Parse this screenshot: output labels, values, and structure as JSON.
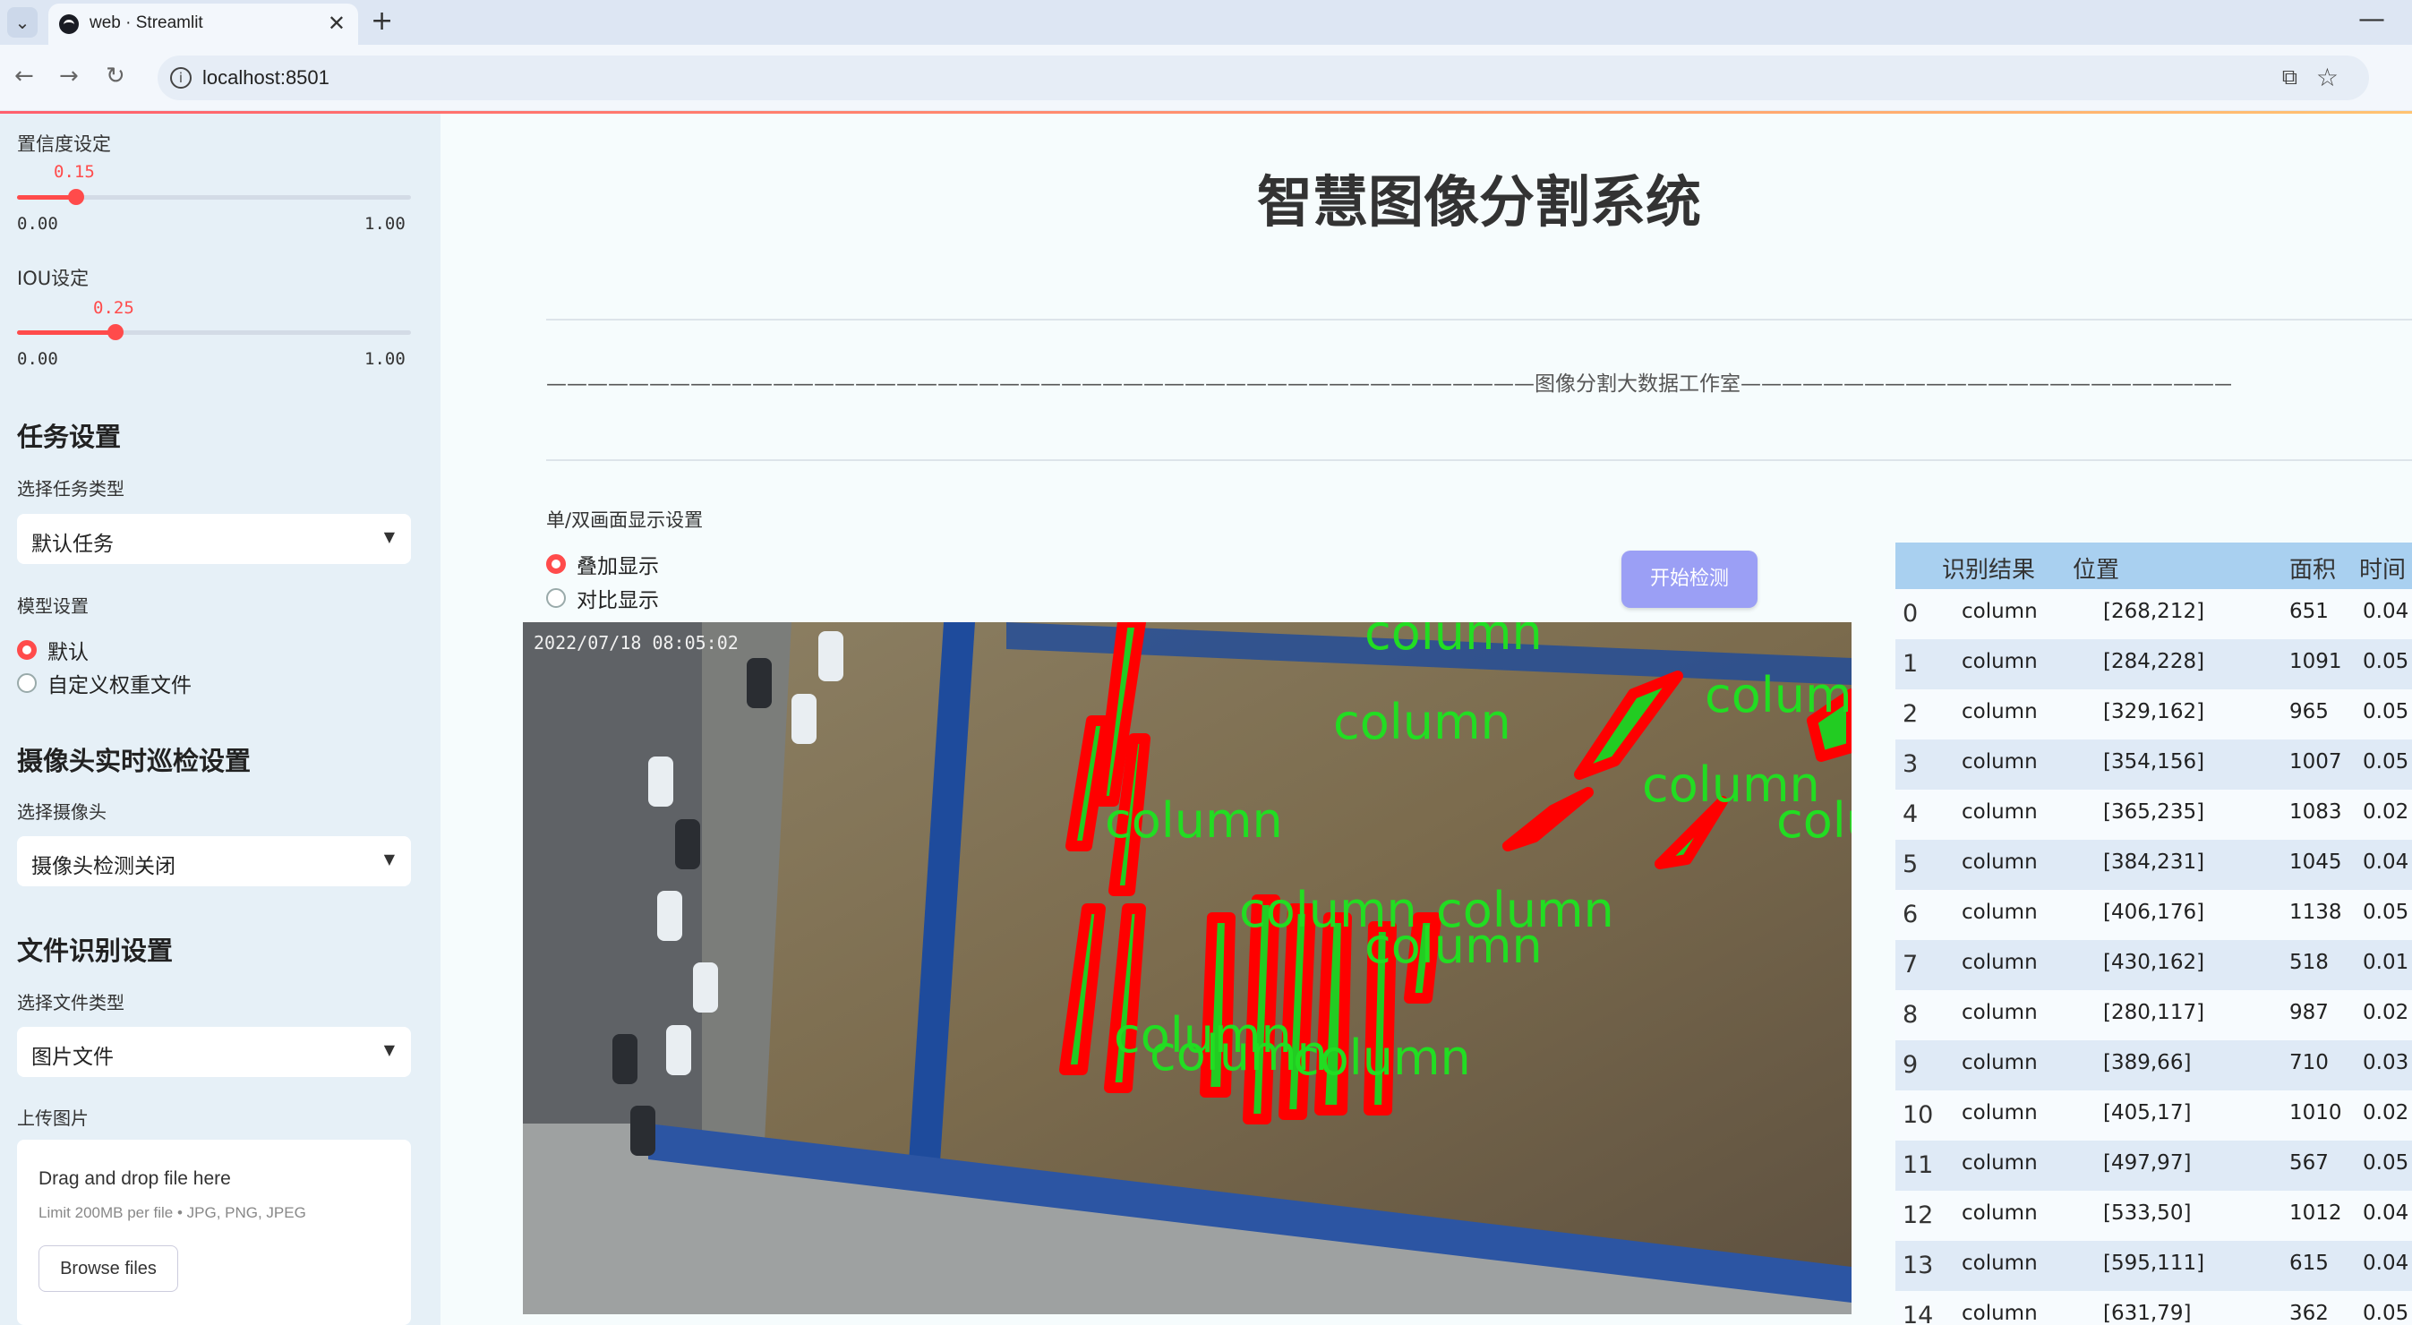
{
  "browser": {
    "tab_title": "web · Streamlit",
    "url": "localhost:8501"
  },
  "sidebar": {
    "confidence": {
      "label": "置信度设定",
      "value": "0.15",
      "value_num": 0.15,
      "min": "0.00",
      "max": "1.00"
    },
    "iou": {
      "label": "IOU设定",
      "value": "0.25",
      "value_num": 0.25,
      "min": "0.00",
      "max": "1.00"
    },
    "task_header": "任务设置",
    "task_type_label": "选择任务类型",
    "task_type_value": "默认任务",
    "model_label": "模型设置",
    "model_options": [
      "默认",
      "自定义权重文件"
    ],
    "model_selected": 0,
    "camera_header": "摄像头实时巡检设置",
    "camera_label": "选择摄像头",
    "camera_value": "摄像头检测关闭",
    "file_header": "文件识别设置",
    "file_type_label": "选择文件类型",
    "file_type_value": "图片文件",
    "upload_label": "上传图片",
    "upload_drag": "Drag and drop file here",
    "upload_limit": "Limit 200MB per file • JPG, PNG, JPEG",
    "upload_button": "Browse files"
  },
  "main": {
    "title": "智慧图像分割系统",
    "banner": "————————————————————————————————————————————————图像分割大数据工作室————————————————————————————————————————————————",
    "display_label": "单/双画面显示设置",
    "display_options": [
      "叠加显示",
      "对比显示"
    ],
    "display_selected": 0,
    "start_button": "开始检测",
    "image": {
      "timestamp": "2022/07/18 08:05:02",
      "detection_label": "column"
    }
  },
  "table": {
    "headers": [
      "识别结果",
      "位置",
      "面积",
      "时间"
    ],
    "rows": [
      {
        "idx": "0",
        "result": "column",
        "pos": "[268,212]",
        "area": "651",
        "time": "0.04"
      },
      {
        "idx": "1",
        "result": "column",
        "pos": "[284,228]",
        "area": "1091",
        "time": "0.05"
      },
      {
        "idx": "2",
        "result": "column",
        "pos": "[329,162]",
        "area": "965",
        "time": "0.05"
      },
      {
        "idx": "3",
        "result": "column",
        "pos": "[354,156]",
        "area": "1007",
        "time": "0.05"
      },
      {
        "idx": "4",
        "result": "column",
        "pos": "[365,235]",
        "area": "1083",
        "time": "0.02"
      },
      {
        "idx": "5",
        "result": "column",
        "pos": "[384,231]",
        "area": "1045",
        "time": "0.04"
      },
      {
        "idx": "6",
        "result": "column",
        "pos": "[406,176]",
        "area": "1138",
        "time": "0.05"
      },
      {
        "idx": "7",
        "result": "column",
        "pos": "[430,162]",
        "area": "518",
        "time": "0.01"
      },
      {
        "idx": "8",
        "result": "column",
        "pos": "[280,117]",
        "area": "987",
        "time": "0.02"
      },
      {
        "idx": "9",
        "result": "column",
        "pos": "[389,66]",
        "area": "710",
        "time": "0.03"
      },
      {
        "idx": "10",
        "result": "column",
        "pos": "[405,17]",
        "area": "1010",
        "time": "0.02"
      },
      {
        "idx": "11",
        "result": "column",
        "pos": "[497,97]",
        "area": "567",
        "time": "0.05"
      },
      {
        "idx": "12",
        "result": "column",
        "pos": "[533,50]",
        "area": "1012",
        "time": "0.04"
      },
      {
        "idx": "13",
        "result": "column",
        "pos": "[595,111]",
        "area": "615",
        "time": "0.04"
      },
      {
        "idx": "14",
        "result": "column",
        "pos": "[631,79]",
        "area": "362",
        "time": "0.05"
      }
    ]
  },
  "colors": {
    "accent": "#ff4b4b",
    "sidebar_bg": "#e6f0f7",
    "button": "#9b9ff5",
    "table_header": "#a9d0f0",
    "detection_box": "#ff0000",
    "detection_text": "#22dd22"
  }
}
